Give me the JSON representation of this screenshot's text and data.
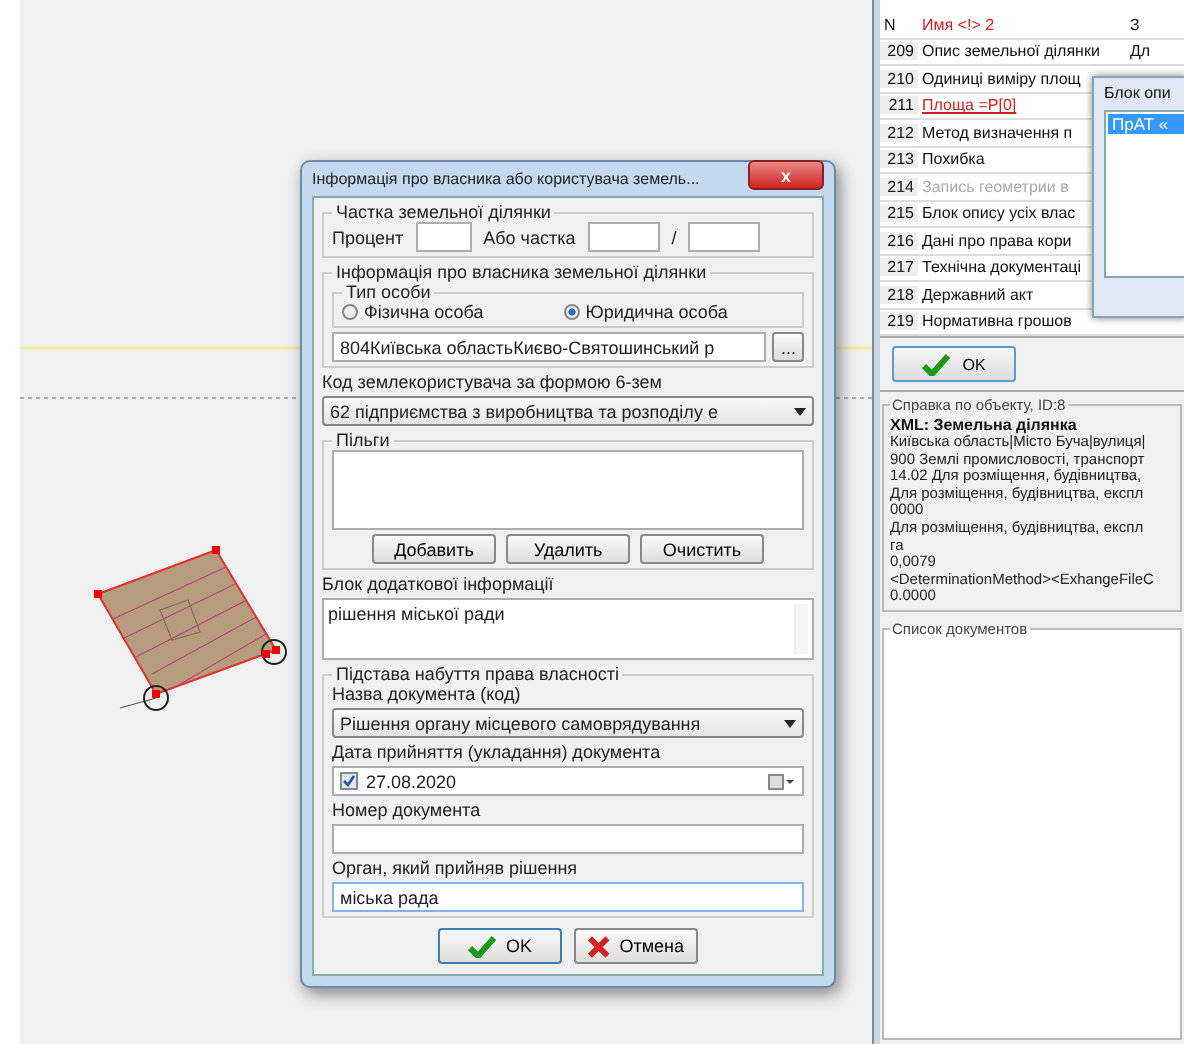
{
  "object_table": {
    "columns": [
      "N",
      "Имя <!> 2",
      "З"
    ],
    "rows": [
      {
        "n": "209",
        "name": "Опис земельної ділянки",
        "column_3": "Дл",
        "kind": "normal"
      },
      {
        "n": "210",
        "name": "Одиниці виміру площ",
        "kind": "normal"
      },
      {
        "n": "211",
        "name": "Площа =P[0]",
        "kind": "link"
      },
      {
        "n": "212",
        "name": "Метод визначення п",
        "kind": "normal"
      },
      {
        "n": "213",
        "name": "Похибка",
        "kind": "normal"
      },
      {
        "n": "214",
        "name": "Запись геометрии в",
        "kind": "disabled"
      },
      {
        "n": "215",
        "name": "Блок опису усіх влас",
        "kind": "normal"
      },
      {
        "n": "216",
        "name": "Дані про права кори",
        "kind": "normal"
      },
      {
        "n": "217",
        "name": "Технічна документаці",
        "kind": "normal"
      },
      {
        "n": "218",
        "name": "Державний акт",
        "kind": "normal"
      },
      {
        "n": "219",
        "name": "Нормативна грошов",
        "kind": "normal"
      }
    ]
  },
  "list_dialog": {
    "title": "Блок опи",
    "items": [
      {
        "label": "ПрАТ «",
        "selected": true
      }
    ]
  },
  "ok_button": "OK",
  "object_info": {
    "legend": "Справка по объекту, ID:8",
    "heading": "XML: Земельна ділянка",
    "lines": [
      "Київська область|Місто Буча|вулиця|",
      "900 Землі промисловості, транспорт",
      "14.02 Для розміщення, будівництва,",
      "Для розміщення, будівництва, експл",
      "0000",
      "Для розміщення, будівництва, експл",
      "га",
      "0,0079",
      "<DeterminationMethod><ExhangeFileC",
      "0.0000"
    ]
  },
  "documents": {
    "legend": "Список документов"
  },
  "owner_dialog": {
    "title": "Інформація про власника або користувача земель...",
    "close": "x",
    "share": {
      "legend": "Частка земельної ділянки",
      "percent_label": "Процент",
      "fraction_label": "Або частка",
      "separator": "/"
    },
    "owner": {
      "legend": "Інформація про власника земельної ділянки",
      "person_type": {
        "legend": "Тип особи",
        "options": [
          {
            "label": "Фізична особа",
            "selected": false
          },
          {
            "label": "Юридична особа",
            "selected": true
          }
        ]
      },
      "address": "804Київська областьКиєво-Святошинський р",
      "browse": "..."
    },
    "user_code_label": "Код землекористувача за формою 6-зем",
    "user_code": "62 підприємства з виробництва та розподілу е",
    "benefits": {
      "legend": "Пільги",
      "buttons": [
        "Добавить",
        "Удалить",
        "Очистить"
      ]
    },
    "extra_label": "Блок додаткової інформації",
    "extra_text": "рішення міської ради",
    "basis": {
      "legend": "Підстава набуття права власності",
      "doc_name_label": "Назва документа (код)",
      "doc_name": "Рішення органу місцевого самоврядування",
      "date_label": "Дата прийняття (укладання) документа",
      "date": {
        "checked": true,
        "value": "27.08.2020"
      },
      "number_label": "Номер документа",
      "authority_label": "Орган, який прийняв рішення",
      "authority": "міська рада"
    },
    "buttons": [
      {
        "kind": "ok",
        "label": "OK"
      },
      {
        "kind": "cancel",
        "label": "Отмена"
      }
    ]
  }
}
